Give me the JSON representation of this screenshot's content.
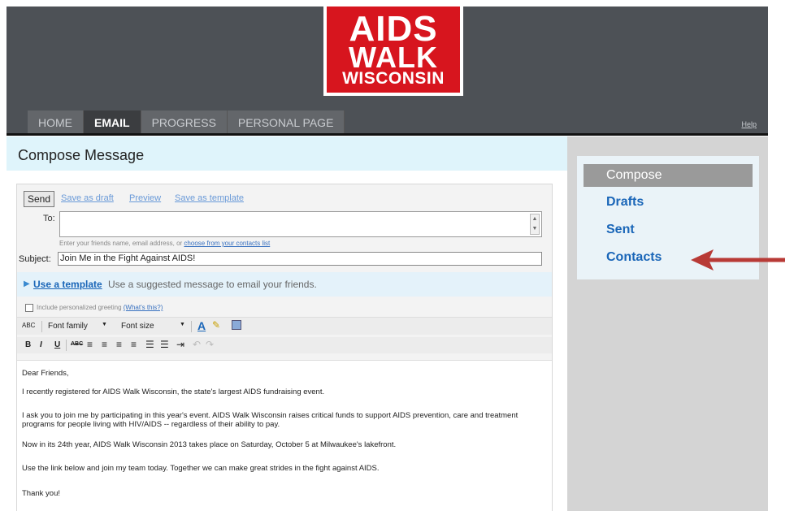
{
  "header": {
    "logo": {
      "line1": "AIDS",
      "line2": "WALK",
      "line3": "WISCONSIN",
      "bg": "#d7151e"
    },
    "nav": [
      {
        "label": "HOME"
      },
      {
        "label": "EMAIL"
      },
      {
        "label": "PROGRESS"
      },
      {
        "label": "PERSONAL PAGE"
      }
    ],
    "help": "Help"
  },
  "page_title": "Compose Message",
  "compose": {
    "send": "Send",
    "save_draft": "Save as draft",
    "preview": "Preview",
    "save_template": "Save as template",
    "to_label": "To:",
    "to_value": "",
    "to_hint_prefix": "Enter your friends name, email address, or",
    "to_hint_link": "choose from your contacts list",
    "subject_label": "Subject:",
    "subject_value": "Join Me in the Fight Against AIDS!",
    "use_template": "Use a template",
    "template_desc": "Use a suggested message to email your friends.",
    "greeting_label": "Include personalized greeting",
    "greeting_link": "(What's this?)",
    "toolbar": {
      "font_family": "Font family",
      "font_size": "Font size",
      "bold": "B",
      "italic": "I",
      "underline": "U",
      "strike": "ABC"
    },
    "body": [
      "Dear Friends,",
      "I recently registered for AIDS Walk Wisconsin, the state's largest AIDS fundraising event.",
      "I ask you to join me by participating in this year's event. AIDS Walk Wisconsin raises critical funds to support AIDS prevention, care and treatment programs for people living with HIV/AIDS -- regardless of their ability to pay.",
      "Now in its 24th year, AIDS Walk Wisconsin 2013 takes place on Saturday, October 5 at Milwaukee's lakefront.",
      "Use the link below and join my team today. Together we can make great strides in the fight against AIDS.",
      "Thank you!"
    ]
  },
  "sidebar": {
    "items": [
      {
        "label": "Compose"
      },
      {
        "label": "Drafts"
      },
      {
        "label": "Sent"
      },
      {
        "label": "Contacts"
      }
    ]
  },
  "colors": {
    "header_bg": "#4d5156",
    "accent_blue": "#1a66b8",
    "arrow": "#b83a36"
  },
  "icons": [
    "spellcheck-icon",
    "text-color-icon",
    "highlight-icon",
    "paste-icon",
    "arrow-icon"
  ]
}
